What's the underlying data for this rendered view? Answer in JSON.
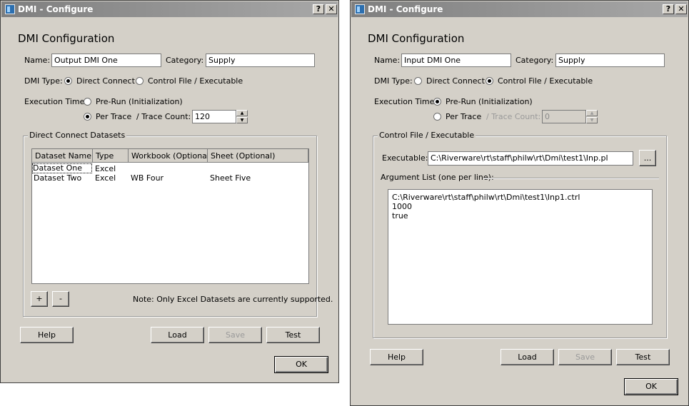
{
  "left": {
    "window_title": "DMI - Configure",
    "help_btn_label": "?",
    "close_btn_label": "✕",
    "heading": "DMI Configuration",
    "name_label": "Name:",
    "name_value": "Output DMI One",
    "category_label": "Category:",
    "category_value": "Supply",
    "dmi_type_label": "DMI Type:",
    "direct_connect_label": "Direct Connect",
    "control_file_label": "Control File / Executable",
    "dmi_type_selected": "Direct Connect",
    "execution_time_label": "Execution Time:",
    "pre_run_label": "Pre-Run (Initialization)",
    "per_trace_label": "Per Trace",
    "execution_selected": "Per Trace",
    "trace_count_label": "/ Trace Count:",
    "trace_count_value": "120",
    "group_title": "Direct Connect Datasets",
    "table": {
      "columns": [
        "Dataset Name",
        "Type",
        "Workbook (Optional)",
        "Sheet (Optional)"
      ],
      "rows": [
        [
          "Dataset One",
          "Excel",
          "",
          ""
        ],
        [
          "Dataset Two",
          "Excel",
          "WB Four",
          "Sheet Five"
        ]
      ]
    },
    "add_btn": "+",
    "remove_btn": "-",
    "note": "Note: Only Excel Datasets are currently supported.",
    "help_button": "Help",
    "load_button": "Load",
    "save_button": "Save",
    "test_button": "Test",
    "ok_button": "OK"
  },
  "right": {
    "window_title": "DMI - Configure",
    "help_btn_label": "?",
    "close_btn_label": "✕",
    "heading": "DMI Configuration",
    "name_label": "Name:",
    "name_value": "Input DMI One",
    "category_label": "Category:",
    "category_value": "Supply",
    "dmi_type_label": "DMI Type:",
    "direct_connect_label": "Direct Connect",
    "control_file_label": "Control File / Executable",
    "dmi_type_selected": "Control File / Executable",
    "execution_time_label": "Execution Time:",
    "pre_run_label": "Pre-Run (Initialization)",
    "per_trace_label": "Per Trace",
    "execution_selected": "Pre-Run (Initialization)",
    "trace_count_label": "/ Trace Count:",
    "trace_count_value": "0",
    "group_title": "Control File / Executable",
    "executable_label": "Executable:",
    "executable_value": "C:\\Riverware\\rt\\staff\\philw\\rt\\Dmi\\test1\\Inp.pl",
    "browse_button": "...",
    "argument_list_label": "Argument List (one per line):",
    "arguments": [
      "C:\\Riverware\\rt\\staff\\philw\\rt\\Dmi\\test1\\Inp1.ctrl",
      "1000",
      "true"
    ],
    "help_button": "Help",
    "load_button": "Load",
    "save_button": "Save",
    "test_button": "Test",
    "ok_button": "OK"
  },
  "colors": {
    "window_bg": "#d4d0c8",
    "titlebar": "#8c8c8c",
    "disabled_text": "#9a9a9a"
  }
}
